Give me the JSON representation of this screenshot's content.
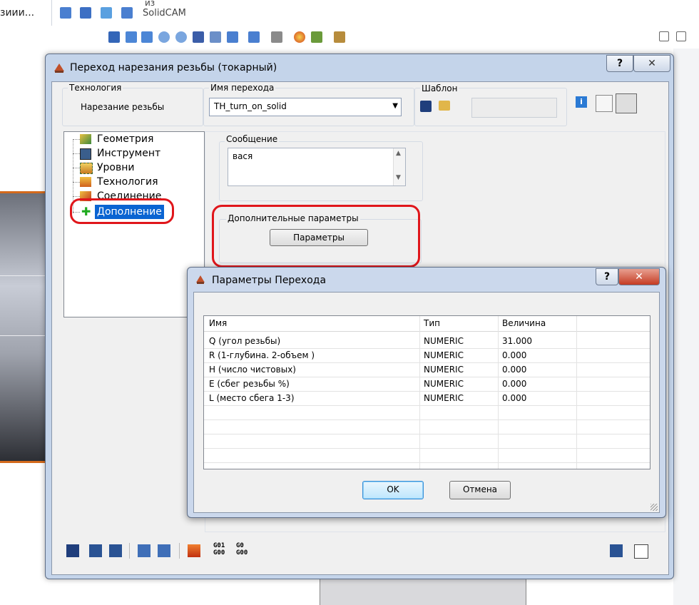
{
  "background": {
    "top_left_text": "зиии...",
    "top_right_text_line1": "из",
    "top_right_text_line2": "SolidCAM"
  },
  "main_dialog": {
    "title": "Переход нарезания резьбы (токарный)",
    "help_button": "?",
    "close_button": "✕",
    "technology": {
      "label": "Технология",
      "value": "Нарезание резьбы"
    },
    "operation_name": {
      "label": "Имя перехода",
      "value": "TH_turn_on_solid"
    },
    "template": {
      "label": "Шаблон"
    },
    "tree": {
      "items": [
        {
          "label": "Геометрия",
          "icon": "geometry-icon"
        },
        {
          "label": "Инструмент",
          "icon": "tool-icon"
        },
        {
          "label": "Уровни",
          "icon": "levels-icon"
        },
        {
          "label": "Технология",
          "icon": "technology-icon"
        },
        {
          "label": "Соединение",
          "icon": "link-icon"
        },
        {
          "label": "Дополнение",
          "icon": "plus-icon",
          "selected": true
        }
      ]
    },
    "message": {
      "label": "Сообщение",
      "value": "вася"
    },
    "extra_params": {
      "label": "Дополнительные параметры",
      "button": "Параметры"
    },
    "bottom_codes": {
      "g01": "G01",
      "g00": "G00",
      "g0x": "G0",
      "g00b": "G00"
    }
  },
  "params_dialog": {
    "title": "Параметры Перехода",
    "help_button": "?",
    "close_button": "✕",
    "columns": [
      "Имя",
      "Тип",
      "Величина"
    ],
    "rows": [
      {
        "name": "Q (угол резьбы)",
        "type": "NUMERIC",
        "value": "31.000"
      },
      {
        "name": "R (1-глубина. 2-объем )",
        "type": "NUMERIC",
        "value": "0.000"
      },
      {
        "name": "H (число чистовых)",
        "type": "NUMERIC",
        "value": "0.000"
      },
      {
        "name": "E (сбег резьбы %)",
        "type": "NUMERIC",
        "value": "0.000"
      },
      {
        "name": "L (место сбега 1-3)",
        "type": "NUMERIC",
        "value": "0.000"
      }
    ],
    "ok_button": "OK",
    "cancel_button": "Отмена"
  },
  "colors": {
    "highlight": "#0a64d2",
    "annotation_red": "#e0161b",
    "accent_orange": "#d46a1c"
  }
}
